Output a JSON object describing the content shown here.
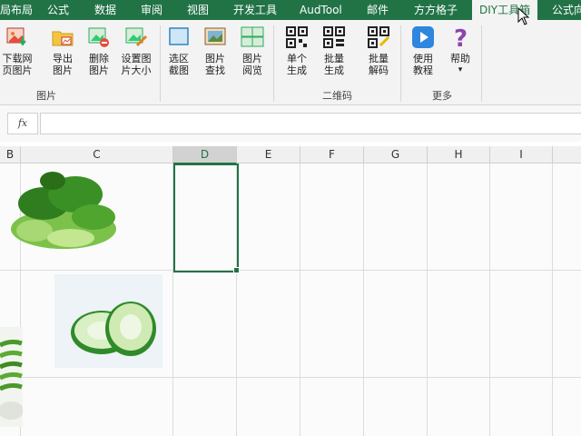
{
  "tabs": [
    {
      "label": "局布局",
      "active": false
    },
    {
      "label": "公式",
      "active": false
    },
    {
      "label": "数据",
      "active": false
    },
    {
      "label": "审阅",
      "active": false
    },
    {
      "label": "视图",
      "active": false
    },
    {
      "label": "开发工具",
      "active": false
    },
    {
      "label": "AudTool",
      "active": false
    },
    {
      "label": "邮件",
      "active": false
    },
    {
      "label": "方方格子",
      "active": false
    },
    {
      "label": "DIY工具箱",
      "active": true
    },
    {
      "label": "公式向",
      "active": false
    }
  ],
  "ribbon": {
    "group_pictures": {
      "label": "图片",
      "buttons": [
        {
          "label1": "下载网",
          "label2": "页图片",
          "icon": "download-picture-icon"
        },
        {
          "label1": "导出",
          "label2": "图片",
          "icon": "export-picture-icon"
        },
        {
          "label1": "删除",
          "label2": "图片",
          "icon": "delete-picture-icon"
        },
        {
          "label1": "设置图",
          "label2": "片大小",
          "icon": "resize-picture-icon"
        }
      ]
    },
    "group_pictures2": {
      "buttons": [
        {
          "label1": "选区",
          "label2": "截图",
          "icon": "screenshot-icon"
        },
        {
          "label1": "图片",
          "label2": "查找",
          "icon": "find-picture-icon"
        },
        {
          "label1": "图片",
          "label2": "阅览",
          "icon": "browse-picture-icon"
        }
      ]
    },
    "group_qrcode": {
      "label": "二维码",
      "buttons": [
        {
          "label1": "单个",
          "label2": "生成",
          "icon": "qr-single-icon"
        },
        {
          "label1": "批量",
          "label2": "生成",
          "icon": "qr-batch-icon"
        },
        {
          "label1": "批量",
          "label2": "解码",
          "icon": "qr-decode-icon"
        }
      ]
    },
    "group_more": {
      "label": "更多",
      "buttons": [
        {
          "label1": "使用",
          "label2": "教程",
          "icon": "tutorial-icon"
        },
        {
          "label1": "帮助",
          "label2": "▾",
          "icon": "help-icon"
        }
      ]
    }
  },
  "formula_bar": {
    "fx": "fx",
    "value": ""
  },
  "columns": [
    "B",
    "C",
    "D",
    "E",
    "F",
    "G",
    "H",
    "I"
  ],
  "selected_column": "D",
  "colors": {
    "accent": "#217346",
    "ribbon_bg": "#f3f3f3"
  }
}
